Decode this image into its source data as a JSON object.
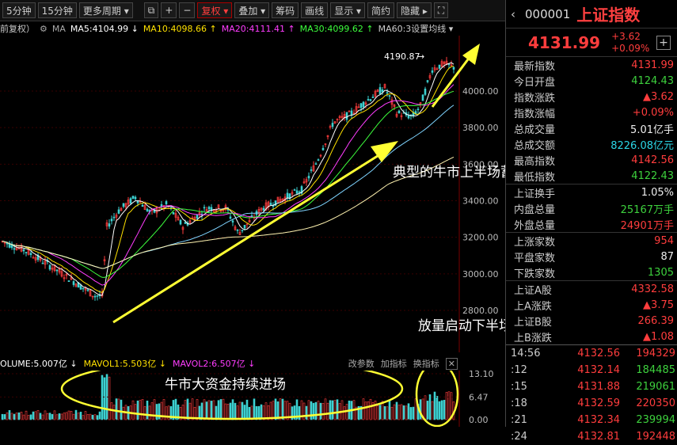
{
  "toolbar": {
    "buttons": [
      {
        "label": "5分钟"
      },
      {
        "label": "15分钟"
      },
      {
        "label": "更多周期 ▾"
      },
      {
        "label": "⧉"
      },
      {
        "label": "+"
      },
      {
        "label": "−"
      },
      {
        "label": "复权 ▾"
      },
      {
        "label": "叠加 ▾"
      },
      {
        "label": "筹码"
      },
      {
        "label": "画线"
      },
      {
        "label": "显示 ▾"
      },
      {
        "label": "简约"
      },
      {
        "label": "隐藏 ▸"
      },
      {
        "label": "⛶"
      }
    ]
  },
  "ma_bar": {
    "prefix": "前复权）",
    "label": "MA",
    "ma5": "MA5:4104.99 ↓",
    "ma10": "MA10:4098.66 ↑",
    "ma20": "MA20:4111.41 ↑",
    "ma30": "MA30:4099.62 ↑",
    "ma60": "MA60:3设置均线 ▾"
  },
  "price_axis": [
    "4000.00",
    "3800.00",
    "3600.00",
    "3400.00",
    "3200.00",
    "3000.00",
    "2800.00"
  ],
  "high_label": "4190.87",
  "annotations": {
    "bull_trend": "典型的牛市上半场蓄势走势",
    "volume_start": "放量启动下半场",
    "big_money": "牛市大资金持续进场"
  },
  "volume_bar": {
    "volume": "OLUME:5.007亿 ↓",
    "mavol1": "MAVOL1:5.503亿 ↓",
    "mavol2": "MAVOL2:6.507亿 ↓",
    "tool1": "改参数",
    "tool2": "加指标",
    "tool3": "换指标",
    "close": "✕"
  },
  "vol_axis": [
    "13.10",
    "6.47",
    "0.00"
  ],
  "quote": {
    "code": "000001",
    "name": "上证指数",
    "price": "4131.99",
    "change": "+3.62",
    "change_pct": "+0.09%",
    "add": "+",
    "rows1": [
      {
        "label": "最新指数",
        "value": "4131.99",
        "color": "red"
      },
      {
        "label": "今日开盘",
        "value": "4124.43",
        "color": "green"
      },
      {
        "label": "指数涨跌",
        "value": "▲3.62",
        "color": "red"
      },
      {
        "label": "指数涨幅",
        "value": "+0.09%",
        "color": "red"
      },
      {
        "label": "总成交量",
        "value": "5.01亿手",
        "color": "white"
      },
      {
        "label": "总成交额",
        "value": "8226.08亿元",
        "color": "cyan"
      },
      {
        "label": "最高指数",
        "value": "4142.56",
        "color": "red"
      },
      {
        "label": "最低指数",
        "value": "4122.43",
        "color": "green"
      }
    ],
    "rows2": [
      {
        "label": "上证换手",
        "value": "1.05%",
        "color": "white"
      },
      {
        "label": "内盘总量",
        "value": "25167万手",
        "color": "green"
      },
      {
        "label": "外盘总量",
        "value": "24901万手",
        "color": "red"
      }
    ],
    "rows3": [
      {
        "label": "上涨家数",
        "value": "954",
        "color": "red"
      },
      {
        "label": "平盘家数",
        "value": "87",
        "color": "white"
      },
      {
        "label": "下跌家数",
        "value": "1305",
        "color": "green"
      }
    ],
    "rows4": [
      {
        "label": "上证A股",
        "value": "4332.58",
        "color": "red"
      },
      {
        "label": "上A涨跌",
        "value": "▲3.75",
        "color": "red"
      },
      {
        "label": "上证B股",
        "value": "266.39",
        "color": "red"
      },
      {
        "label": "上B涨跌",
        "value": "▲1.08",
        "color": "red"
      }
    ],
    "ticks": [
      {
        "time": "14:56",
        "price": "4132.56",
        "vol": "194329",
        "vcolor": "red"
      },
      {
        "time": ":12",
        "price": "4132.14",
        "vol": "184485",
        "vcolor": "green"
      },
      {
        "time": ":15",
        "price": "4131.88",
        "vol": "219061",
        "vcolor": "green"
      },
      {
        "time": ":18",
        "price": "4132.59",
        "vol": "220350",
        "vcolor": "red"
      },
      {
        "time": ":21",
        "price": "4132.34",
        "vol": "239994",
        "vcolor": "green"
      },
      {
        "time": ":24",
        "price": "4132.81",
        "vol": "192448",
        "vcolor": "red"
      }
    ]
  },
  "colors": {
    "up": "#ff3d3d",
    "down": "#3dd13d",
    "ma5": "#ffffff",
    "ma10": "#ffe100",
    "ma20": "#ff3dff",
    "ma30": "#3dff3d",
    "ma60": "#7fd4ff",
    "annotation": "#ffff33"
  }
}
